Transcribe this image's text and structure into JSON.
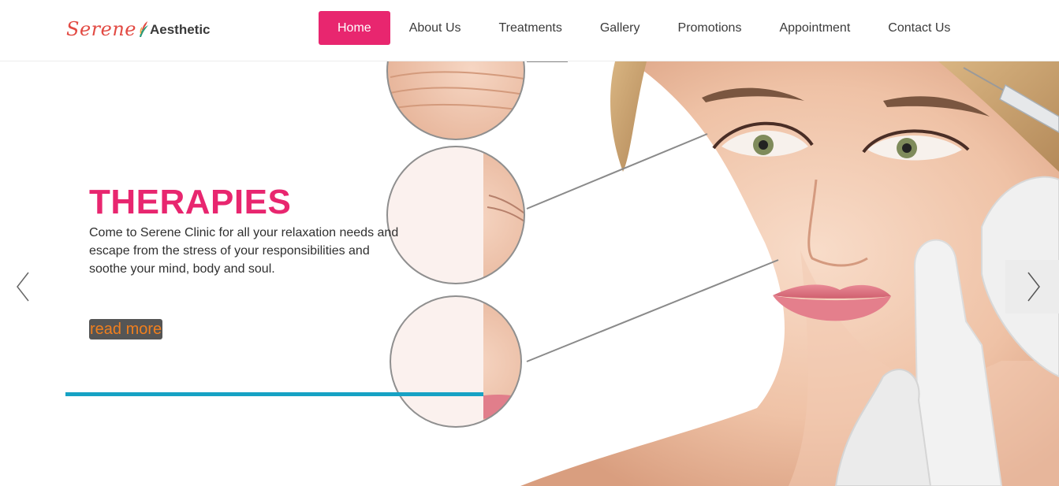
{
  "brand": {
    "name_part1": "Serene",
    "name_part2": "Aesthetic"
  },
  "nav": {
    "items": [
      {
        "label": "Home",
        "active": true
      },
      {
        "label": "About Us"
      },
      {
        "label": "Treatments"
      },
      {
        "label": "Gallery"
      },
      {
        "label": "Promotions"
      },
      {
        "label": "Appointment"
      },
      {
        "label": "Contact Us"
      }
    ]
  },
  "hero": {
    "title": "THERAPIES",
    "description": "Come to Serene Clinic for all your relaxation needs and escape from the stress of your responsibilities and soothe your mind, body and soul.",
    "cta_label": "read more",
    "prev_icon": "chevron-left-icon",
    "next_icon": "chevron-right-icon"
  },
  "colors": {
    "accent_pink": "#e8266f",
    "accent_blue": "#16a2c4",
    "logo_red": "#e24a43",
    "cta_text": "#f07f1e"
  }
}
